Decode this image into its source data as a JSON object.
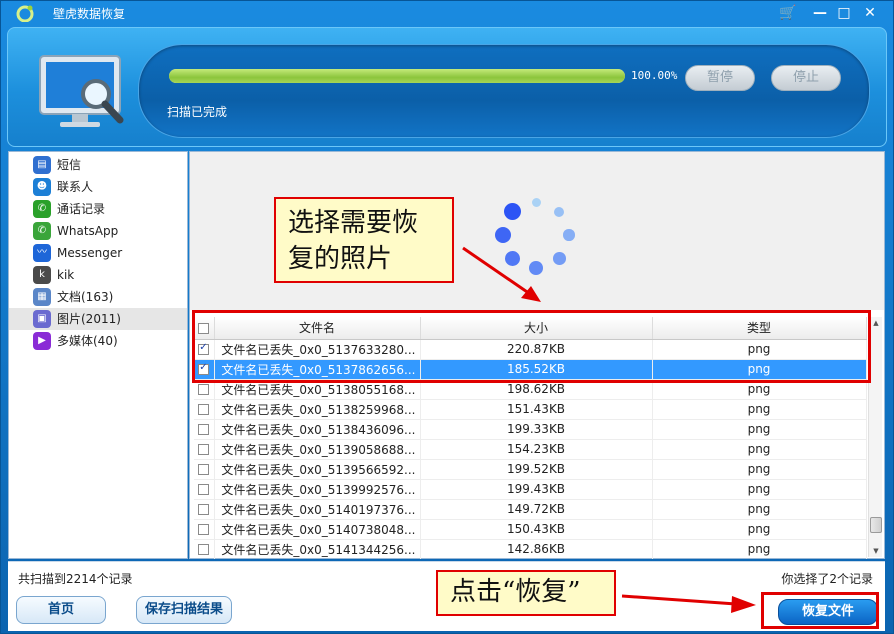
{
  "window": {
    "title": "壁虎数据恢复",
    "controls": [
      "🛒",
      "—",
      "□",
      "✕"
    ]
  },
  "progress": {
    "percent": 100,
    "percent_label": "100.00%",
    "status": "扫描已完成",
    "pause_label": "暂停",
    "stop_label": "停止"
  },
  "sidebar": {
    "items": [
      {
        "label": "短信",
        "icon": "sms-icon",
        "color": "#2f6fd0"
      },
      {
        "label": "联系人",
        "icon": "contacts-icon",
        "color": "#1c7fd6"
      },
      {
        "label": "通话记录",
        "icon": "phone-icon",
        "color": "#2aa12a"
      },
      {
        "label": "WhatsApp",
        "icon": "whatsapp-icon",
        "color": "#3aa53a"
      },
      {
        "label": "Messenger",
        "icon": "messenger-icon",
        "color": "#1e66d8"
      },
      {
        "label": "kik",
        "icon": "kik-icon",
        "color": "#4a4a4a"
      },
      {
        "label": "文档(163)",
        "icon": "document-icon",
        "color": "#5a86c8"
      },
      {
        "label": "图片(2011)",
        "icon": "image-icon",
        "color": "#6a6ad0"
      },
      {
        "label": "多媒体(40)",
        "icon": "media-icon",
        "color": "#8a2bd6"
      }
    ],
    "selected_index": 7
  },
  "callouts": {
    "select_photos": "选择需要恢复的照片",
    "click_recover": "点击“恢复”"
  },
  "table": {
    "headers": [
      "文件名",
      "大小",
      "类型"
    ],
    "rows": [
      {
        "checked": true,
        "name": "文件名已丢失_0x0_5137633280...",
        "size": "220.87KB",
        "type": "png"
      },
      {
        "checked": true,
        "name": "文件名已丢失_0x0_5137862656...",
        "size": "185.52KB",
        "type": "png"
      },
      {
        "checked": false,
        "name": "文件名已丢失_0x0_5138055168...",
        "size": "198.62KB",
        "type": "png"
      },
      {
        "checked": false,
        "name": "文件名已丢失_0x0_5138259968...",
        "size": "151.43KB",
        "type": "png"
      },
      {
        "checked": false,
        "name": "文件名已丢失_0x0_5138436096...",
        "size": "199.33KB",
        "type": "png"
      },
      {
        "checked": false,
        "name": "文件名已丢失_0x0_5139058688...",
        "size": "154.23KB",
        "type": "png"
      },
      {
        "checked": false,
        "name": "文件名已丢失_0x0_5139566592...",
        "size": "199.52KB",
        "type": "png"
      },
      {
        "checked": false,
        "name": "文件名已丢失_0x0_5139992576...",
        "size": "199.43KB",
        "type": "png"
      },
      {
        "checked": false,
        "name": "文件名已丢失_0x0_5140197376...",
        "size": "149.72KB",
        "type": "png"
      },
      {
        "checked": false,
        "name": "文件名已丢失_0x0_5140738048...",
        "size": "150.43KB",
        "type": "png"
      },
      {
        "checked": false,
        "name": "文件名已丢失_0x0_5141344256...",
        "size": "142.86KB",
        "type": "png"
      }
    ],
    "selected_row": 1
  },
  "status": {
    "total": "共扫描到2214个记录",
    "selected": "你选择了2个记录"
  },
  "footer": {
    "home_label": "首页",
    "save_label": "保存扫描结果",
    "recover_label": "恢复文件"
  },
  "colors": {
    "accent": "#1a8be0",
    "highlight": "#e00000",
    "row_selected": "#3399ff"
  }
}
